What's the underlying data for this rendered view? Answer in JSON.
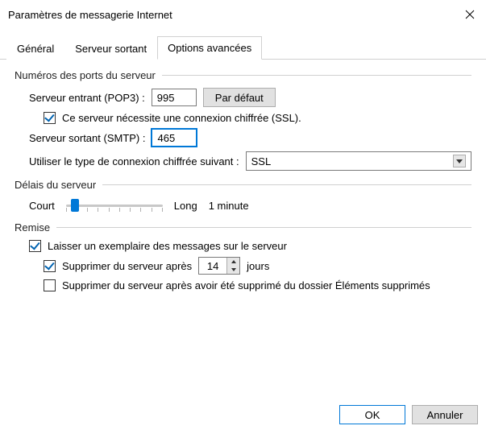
{
  "window": {
    "title": "Paramètres de messagerie Internet"
  },
  "tabs": {
    "general": "Général",
    "outgoing": "Serveur sortant",
    "advanced": "Options avancées"
  },
  "ports": {
    "group_label": "Numéros des ports du serveur",
    "incoming_label": "Serveur entrant (POP3) :",
    "incoming_value": "995",
    "default_btn": "Par défaut",
    "ssl_required_label": "Ce serveur nécessite une connexion chiffrée (SSL).",
    "outgoing_label": "Serveur sortant (SMTP) :",
    "outgoing_value": "465",
    "encryption_label": "Utiliser le type de connexion chiffrée suivant :",
    "encryption_value": "SSL"
  },
  "timeouts": {
    "group_label": "Délais du serveur",
    "short_label": "Court",
    "long_label": "Long",
    "value_label": "1 minute"
  },
  "delivery": {
    "group_label": "Remise",
    "leave_copy_label": "Laisser un exemplaire des messages sur le serveur",
    "remove_after_label": "Supprimer du serveur après",
    "remove_after_days": "14",
    "days_suffix": "jours",
    "remove_when_deleted_label": "Supprimer du serveur après avoir été supprimé du dossier Éléments supprimés"
  },
  "footer": {
    "ok": "OK",
    "cancel": "Annuler"
  }
}
